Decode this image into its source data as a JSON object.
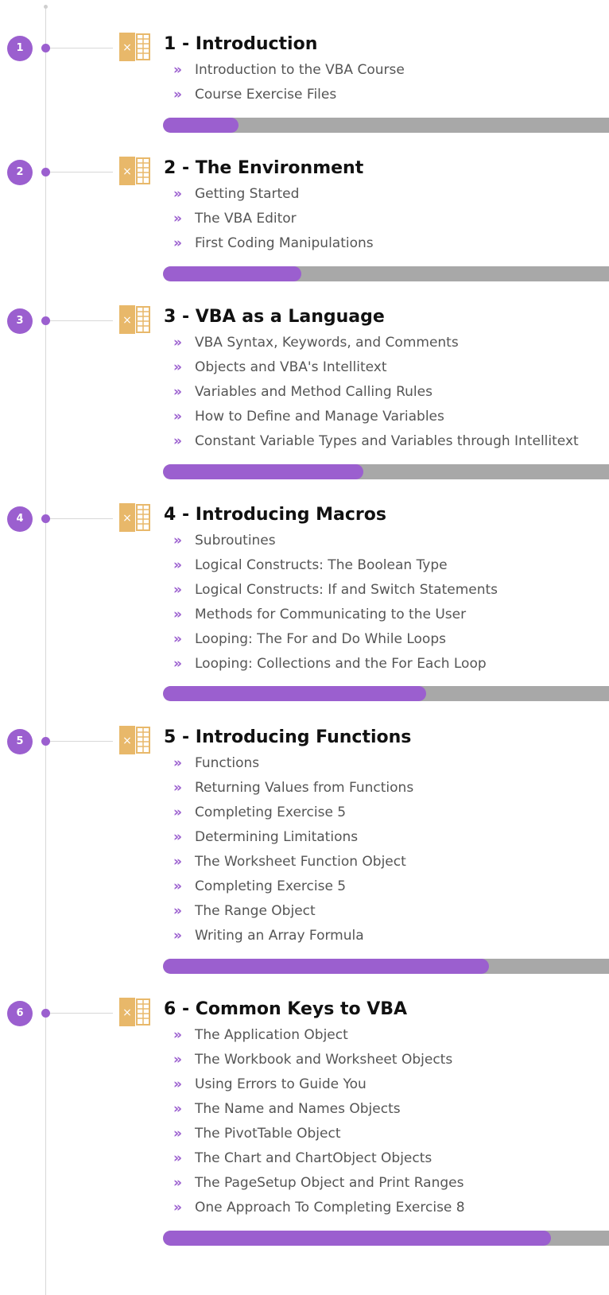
{
  "colors": {
    "accent": "#9b5fcf",
    "progress_track": "#a8a8a8",
    "icon_orange": "#e8b86a",
    "title_text": "#111111",
    "lesson_text": "#555555"
  },
  "modules": [
    {
      "number": "1",
      "title": "1 - Introduction",
      "icon": "excel-file-icon",
      "progress": 0.17,
      "lessons": [
        "Introduction to the VBA Course",
        "Course Exercise Files"
      ]
    },
    {
      "number": "2",
      "title": "2 - The Environment",
      "icon": "excel-file-icon",
      "progress": 0.31,
      "lessons": [
        "Getting Started",
        "The VBA Editor",
        "First Coding Manipulations"
      ]
    },
    {
      "number": "3",
      "title": "3 - VBA as a Language",
      "icon": "excel-file-icon",
      "progress": 0.45,
      "lessons": [
        "VBA Syntax, Keywords, and Comments",
        "Objects and VBA's Intellitext",
        "Variables and Method Calling Rules",
        "How to Define and Manage Variables",
        "Constant Variable Types and Variables through Intellitext"
      ]
    },
    {
      "number": "4",
      "title": "4 - Introducing Macros",
      "icon": "excel-file-icon",
      "progress": 0.59,
      "lessons": [
        "Subroutines",
        "Logical Constructs: The Boolean Type",
        "Logical Constructs: If and Switch Statements",
        "Methods for Communicating to the User",
        "Looping: The For and Do While Loops",
        "Looping: Collections and the For Each Loop"
      ]
    },
    {
      "number": "5",
      "title": "5 - Introducing Functions",
      "icon": "excel-file-icon",
      "progress": 0.73,
      "lessons": [
        "Functions",
        "Returning Values from Functions",
        "Completing Exercise 5",
        "Determining Limitations",
        "The Worksheet Function Object",
        "Completing Exercise 5",
        "The Range Object",
        "Writing an Array Formula"
      ]
    },
    {
      "number": "6",
      "title": "6 - Common Keys to VBA",
      "icon": "excel-file-icon",
      "progress": 0.87,
      "lessons": [
        "The Application Object",
        "The Workbook and Worksheet Objects",
        "Using Errors to Guide You",
        "The Name and Names Objects",
        "The PivotTable Object",
        "The Chart and ChartObject Objects",
        "The PageSetup Object and Print Ranges",
        "One Approach To Completing Exercise 8"
      ]
    }
  ]
}
